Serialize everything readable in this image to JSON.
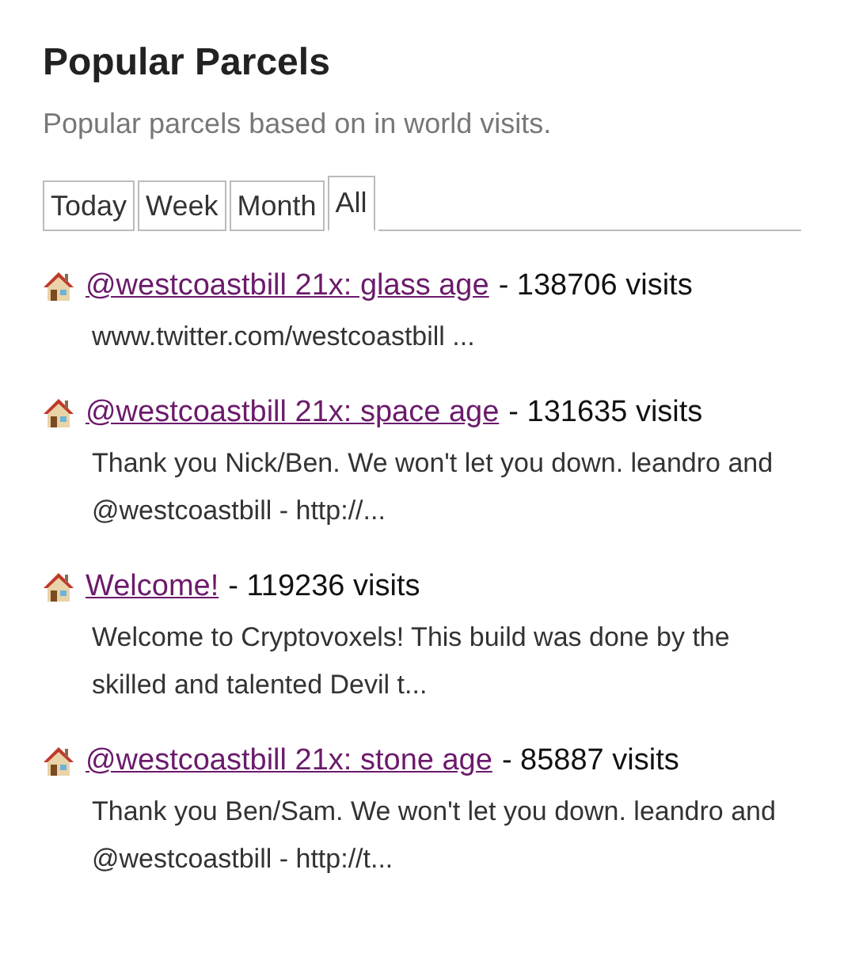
{
  "title": "Popular Parcels",
  "subtitle": "Popular parcels based on in world visits.",
  "tabs": [
    {
      "label": "Today",
      "selected": false
    },
    {
      "label": "Week",
      "selected": false
    },
    {
      "label": "Month",
      "selected": false
    },
    {
      "label": "All",
      "selected": true
    }
  ],
  "parcels": [
    {
      "name": "@westcoastbill 21x: glass age",
      "visits": "- 138706 visits",
      "description": "www.twitter.com/westcoastbill ..."
    },
    {
      "name": "@westcoastbill 21x: space age",
      "visits": "- 131635 visits",
      "description": "Thank you Nick/Ben. We won't let you down. leandro and @westcoastbill - http://..."
    },
    {
      "name": "Welcome!",
      "visits": "- 119236 visits",
      "description": "Welcome to Cryptovoxels! This build was done by the skilled and talented Devil t..."
    },
    {
      "name": "@westcoastbill 21x: stone age",
      "visits": "- 85887 visits",
      "description": "Thank you Ben/Sam. We won't let you down. leandro and @westcoastbill - http://t..."
    }
  ]
}
